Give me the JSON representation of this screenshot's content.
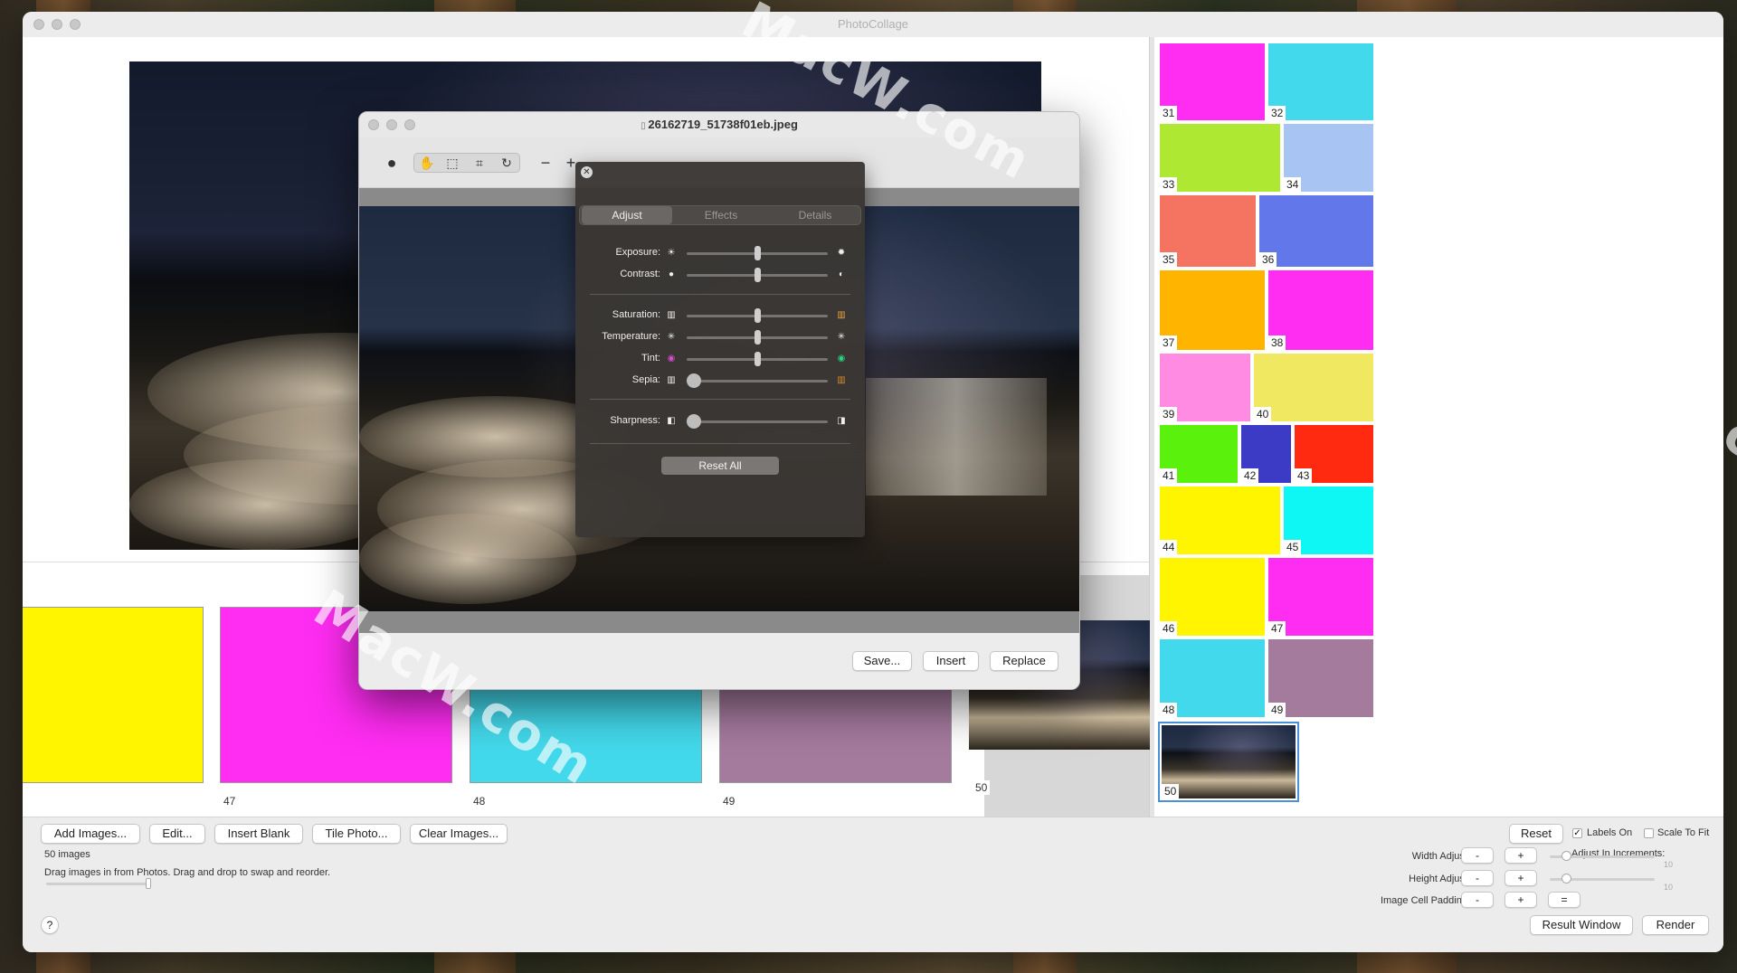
{
  "main_window": {
    "title": "PhotoCollage"
  },
  "editor": {
    "filename": "26162719_51738f01eb.jpeg",
    "toolbar": {
      "tools": [
        "circle-icon",
        "hand-icon",
        "marquee-icon",
        "crop-icon",
        "rotate-icon",
        "minus-icon",
        "plus-icon"
      ]
    },
    "buttons": {
      "save": "Save...",
      "insert": "Insert",
      "replace": "Replace"
    }
  },
  "adjust_panel": {
    "tabs": [
      "Adjust",
      "Effects",
      "Details"
    ],
    "active_tab": "Adjust",
    "sliders": [
      {
        "label": "Exposure:",
        "value": 0.5
      },
      {
        "label": "Contrast:",
        "value": 0.5
      },
      {
        "label": "Saturation:",
        "value": 0.5
      },
      {
        "label": "Temperature:",
        "value": 0.5
      },
      {
        "label": "Tint:",
        "value": 0.5
      },
      {
        "label": "Sepia:",
        "value": 0.0
      },
      {
        "label": "Sharpness:",
        "value": 0.0
      }
    ],
    "reset_label": "Reset All"
  },
  "strip": {
    "cells": [
      {
        "label": "",
        "color": "#fff500"
      },
      {
        "label": "47",
        "color": "#ff2cf2"
      },
      {
        "label": "48",
        "color": "#43d9ec"
      },
      {
        "label": "49",
        "color": "#a47a9d"
      },
      {
        "label": "50",
        "color": "photo"
      }
    ]
  },
  "grid": {
    "cells": [
      {
        "label": "31",
        "color": "#ff2cf2"
      },
      {
        "label": "32",
        "color": "#43d9ec"
      },
      {
        "label": "33",
        "color": "#aee832"
      },
      {
        "label": "34",
        "color": "#a7c4f2"
      },
      {
        "label": "35",
        "color": "#f47461"
      },
      {
        "label": "36",
        "color": "#6277ea"
      },
      {
        "label": "37",
        "color": "#ffb400"
      },
      {
        "label": "38",
        "color": "#ff2cf2"
      },
      {
        "label": "39",
        "color": "#ff8ce2"
      },
      {
        "label": "40",
        "color": "#f1e861"
      },
      {
        "label": "41",
        "color": "#5af10d"
      },
      {
        "label": "42",
        "color": "#3b3bc6"
      },
      {
        "label": "43",
        "color": "#ff2a10"
      },
      {
        "label": "44",
        "color": "#fff500"
      },
      {
        "label": "45",
        "color": "#0ff7f5"
      },
      {
        "label": "46",
        "color": "#fff500"
      },
      {
        "label": "47",
        "color": "#ff2cf2"
      },
      {
        "label": "48",
        "color": "#43d9ec"
      },
      {
        "label": "49",
        "color": "#a47a9d"
      },
      {
        "label": "50",
        "color": "photo"
      }
    ]
  },
  "bottom": {
    "buttons": {
      "add_images": "Add Images...",
      "edit": "Edit...",
      "insert_blank": "Insert Blank",
      "tile_photo": "Tile Photo...",
      "clear_images": "Clear Images..."
    },
    "image_count": "50 images",
    "hint": "Drag images in from Photos. Drag and drop to swap and reorder.",
    "help": "?",
    "reset": "Reset",
    "labels_on": "Labels On",
    "labels_on_checked": true,
    "scale_to_fit": "Scale To Fit",
    "scale_to_fit_checked": false,
    "adjust_increments": "Adjust In Increments:",
    "width_adjust": "Width Adjust:",
    "height_adjust": "Height Adjust:",
    "cell_padding": "Image Cell Padding:",
    "minus": "-",
    "plus": "+",
    "equals": "=",
    "increment_value": "10",
    "result_window": "Result Window",
    "render": "Render"
  },
  "watermarks": [
    "MacW.com",
    "MacW.com",
    "MacW.com"
  ],
  "colors": {
    "panel_bg": "#3a3734",
    "window_bg": "#ececec"
  }
}
